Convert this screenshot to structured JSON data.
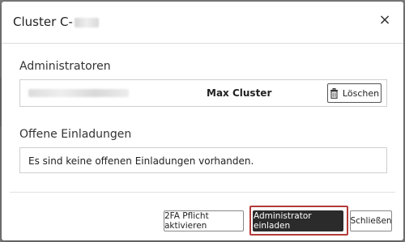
{
  "modal": {
    "title": "Cluster C-",
    "close_label": "×"
  },
  "administrators": {
    "section_title": "Administratoren",
    "rows": [
      {
        "name": "Max Cluster",
        "delete_label": "Löschen"
      }
    ]
  },
  "invitations": {
    "section_title": "Offene Einladungen",
    "empty_text": "Es sind keine offenen Einladungen vorhanden."
  },
  "footer": {
    "twofa_label": "2FA Pflicht aktivieren",
    "invite_label": "Administrator einladen",
    "close_label": "Schließen"
  },
  "colors": {
    "primary": "#2b2b2b",
    "highlight": "#b33a3a"
  },
  "icons": {
    "delete": "trash-icon",
    "close": "close-icon"
  }
}
